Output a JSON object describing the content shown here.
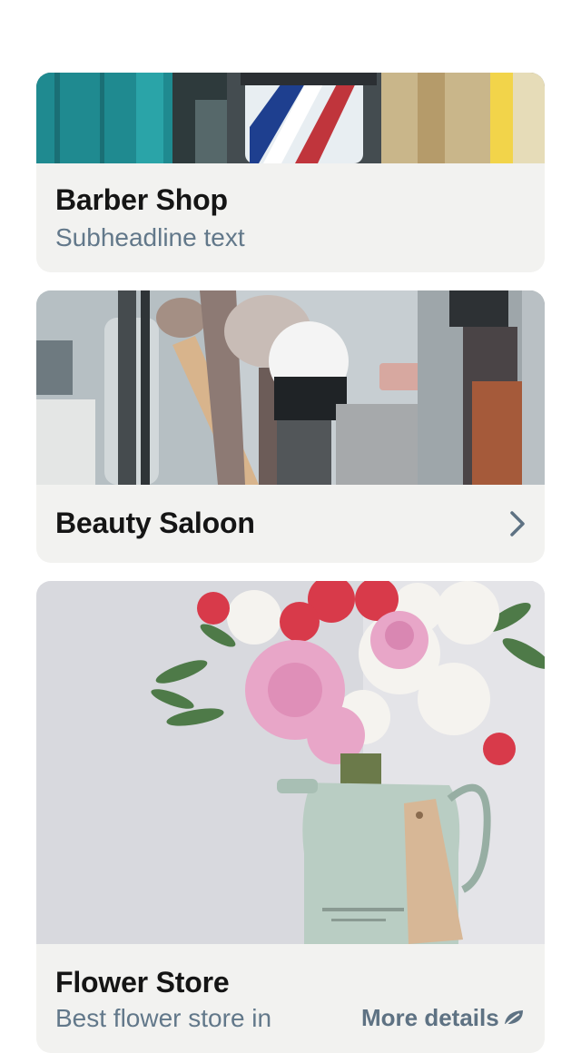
{
  "cards": [
    {
      "title": "Barber Shop",
      "subtitle": "Subheadline text"
    },
    {
      "title": "Beauty Saloon",
      "action_icon": "chevron-right-icon"
    },
    {
      "title": "Flower Store",
      "subtitle": "Best flower store in",
      "more_label": "More details",
      "more_icon": "leaf-icon"
    }
  ],
  "colors": {
    "card_background": "#f2f2f0",
    "title_text": "#151515",
    "subtitle_text": "#62788a",
    "accent_text": "#5e7283"
  }
}
